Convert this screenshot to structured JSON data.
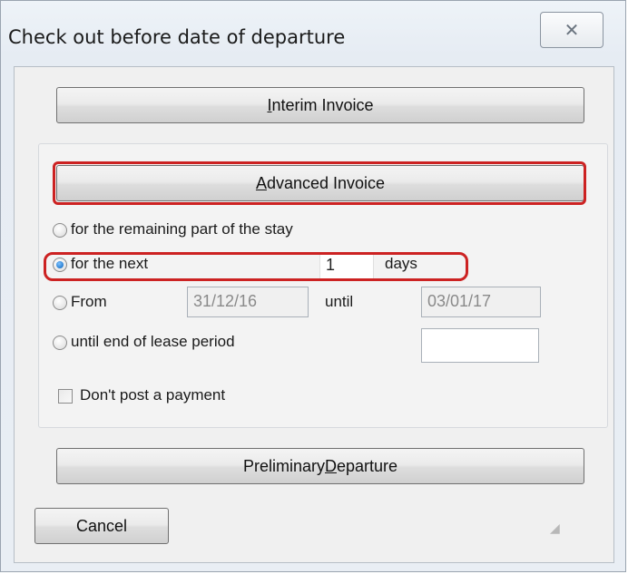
{
  "window": {
    "title": "Check out before date of departure",
    "close_symbol": "✕"
  },
  "buttons": {
    "interim_invoice": {
      "pre": "",
      "accel": "I",
      "post": "nterim Invoice"
    },
    "advanced_invoice": {
      "pre": "",
      "accel": "A",
      "post": "dvanced Invoice"
    },
    "preliminary_departure": {
      "pre": "Preliminary ",
      "accel": "D",
      "post": "eparture"
    },
    "cancel": "Cancel"
  },
  "options": {
    "remaining_stay": {
      "label": "for the remaining part of the stay",
      "checked": false
    },
    "for_the_next": {
      "label": "for the next",
      "checked": true,
      "value": "1",
      "unit": "days"
    },
    "from": {
      "label": "From",
      "checked": false,
      "from_value": "31/12/16",
      "until_label": "until",
      "until_value": "03/01/17"
    },
    "end_of_lease": {
      "label": "until end of lease period",
      "checked": false,
      "value": ""
    }
  },
  "checkbox": {
    "no_payment": {
      "label": "Don't post a payment",
      "checked": false
    }
  },
  "colors": {
    "highlight": "#cc2222",
    "radio_selected": "#1b73c9"
  },
  "icons": {
    "close": "close-icon",
    "resize_grip": "resize-grip-icon"
  }
}
